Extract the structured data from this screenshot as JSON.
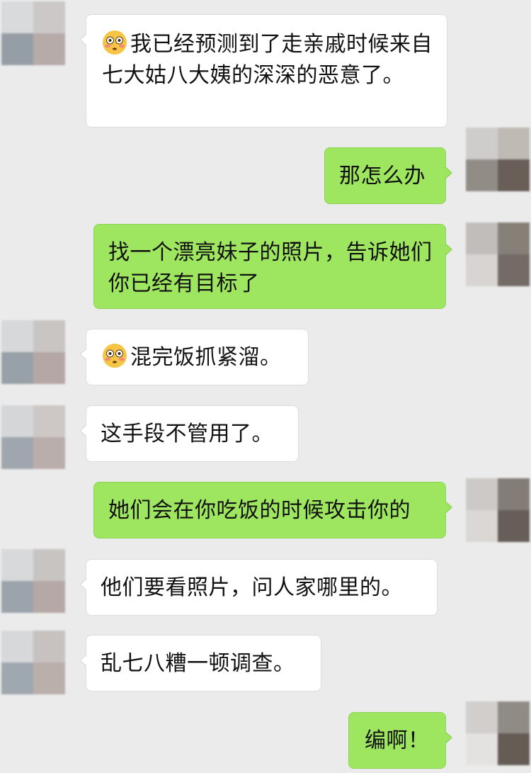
{
  "messages": [
    {
      "side": "left",
      "emoji": "flushed-icon",
      "text": "我已经预测到了走亲戚时候来自七大姑八大姨的深深的恶意了。"
    },
    {
      "side": "right",
      "text": "那怎么办"
    },
    {
      "side": "right",
      "text": "找一个漂亮妹子的照片，告诉她们你已经有目标了"
    },
    {
      "side": "left",
      "emoji": "flushed-icon",
      "text": "混完饭抓紧溜。"
    },
    {
      "side": "left",
      "text": "这手段不管用了。"
    },
    {
      "side": "right",
      "text": "她们会在你吃饭的时候攻击你的"
    },
    {
      "side": "left",
      "text": "他们要看照片，问人家哪里的。"
    },
    {
      "side": "left",
      "text": "乱七八糟一顿调查。"
    },
    {
      "side": "right",
      "text": "编啊！"
    }
  ],
  "colors": {
    "background": "#ebebeb",
    "incoming_bubble": "#ffffff",
    "outgoing_bubble": "#9ee560"
  },
  "avatars": {
    "left": "blurred-avatar",
    "right": "blurred-avatar"
  }
}
